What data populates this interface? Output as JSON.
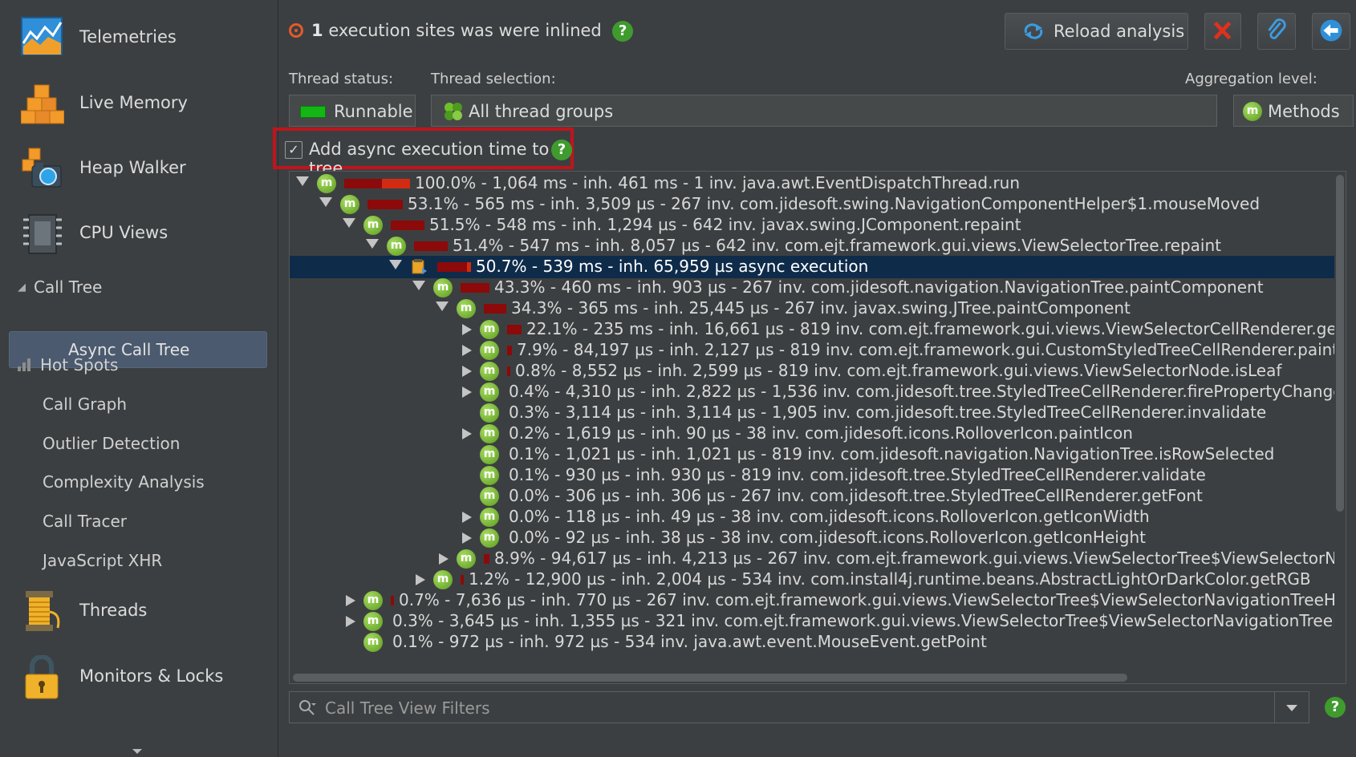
{
  "sidebar": {
    "big_items": [
      {
        "label": "Telemetries",
        "icon": "telemetries-icon"
      },
      {
        "label": "Live Memory",
        "icon": "live-memory-icon"
      },
      {
        "label": "Heap Walker",
        "icon": "heap-walker-icon"
      },
      {
        "label": "CPU Views",
        "icon": "cpu-views-icon"
      }
    ],
    "call_tree": {
      "label": "Call Tree",
      "children": [
        {
          "label": "Async Call Tree",
          "selected": true
        }
      ]
    },
    "hot_spots": {
      "label": "Hot Spots"
    },
    "sub_items": [
      "Call Graph",
      "Outlier Detection",
      "Complexity Analysis",
      "Call Tracer",
      "JavaScript XHR"
    ],
    "bottom_items": [
      {
        "label": "Threads",
        "icon": "threads-icon"
      },
      {
        "label": "Monitors & Locks",
        "icon": "monitors-locks-icon"
      }
    ]
  },
  "header": {
    "inlined_count": "1",
    "inlined_text": "execution sites was were inlined",
    "reload_label": "Reload analysis"
  },
  "filters": {
    "thread_status_label": "Thread status:",
    "thread_status_value": "Runnable",
    "thread_selection_label": "Thread selection:",
    "thread_selection_value": "All thread groups",
    "aggregation_label": "Aggregation level:",
    "aggregation_value": "Methods",
    "async_checkbox_label": "Add async execution time to tree",
    "async_checked": true
  },
  "tree": {
    "rows": [
      {
        "text": "100.0% - 1,064 ms - inh. 461 ms - 1 inv. java.awt.EventDispatchThread.run",
        "depth": 0,
        "expander": "down",
        "percent": 100.0,
        "self_fraction": 0.43
      },
      {
        "text": "53.1% - 565 ms - inh. 3,509 µs - 267 inv. com.jidesoft.swing.NavigationComponentHelper$1.mouseMoved",
        "depth": 1,
        "expander": "down",
        "percent": 53.1,
        "self_fraction": 0.0
      },
      {
        "text": "51.5% - 548 ms - inh. 1,294 µs - 642 inv. javax.swing.JComponent.repaint",
        "depth": 2,
        "expander": "down",
        "percent": 51.5,
        "self_fraction": 0.0
      },
      {
        "text": "51.4% - 547 ms - inh. 8,057 µs - 642 inv. com.ejt.framework.gui.views.ViewSelectorTree.repaint",
        "depth": 3,
        "expander": "down",
        "percent": 51.4,
        "self_fraction": 0.0
      },
      {
        "text": "50.7% - 539 ms - inh. 65,959 µs async execution",
        "depth": 4,
        "expander": "down",
        "percent": 50.7,
        "self_fraction": 0.12,
        "async": true,
        "selected": true
      },
      {
        "text": "43.3% - 460 ms - inh. 903 µs - 267 inv. com.jidesoft.navigation.NavigationTree.paintComponent",
        "depth": 5,
        "expander": "down",
        "percent": 43.3,
        "self_fraction": 0.0
      },
      {
        "text": "34.3% - 365 ms - inh. 25,445 µs - 267 inv. javax.swing.JTree.paintComponent",
        "depth": 6,
        "expander": "down",
        "percent": 34.3,
        "self_fraction": 0.0
      },
      {
        "text": "22.1% - 235 ms - inh. 16,661 µs - 819 inv. com.ejt.framework.gui.views.ViewSelectorCellRenderer.getTreeCel",
        "depth": 7,
        "expander": "right",
        "percent": 22.1,
        "self_fraction": 0.0
      },
      {
        "text": "7.9% - 84,197 µs - inh. 2,127 µs - 819 inv. com.ejt.framework.gui.CustomStyledTreeCellRenderer.paint",
        "depth": 7,
        "expander": "right",
        "percent": 7.9,
        "self_fraction": 0.0
      },
      {
        "text": "0.8% - 8,552 µs - inh. 2,599 µs - 819 inv. com.ejt.framework.gui.views.ViewSelectorNode.isLeaf",
        "depth": 7,
        "expander": "right",
        "percent": 0.8,
        "self_fraction": 0.0
      },
      {
        "text": "0.4% - 4,310 µs - inh. 2,822 µs - 1,536 inv. com.jidesoft.tree.StyledTreeCellRenderer.firePropertyChange",
        "depth": 7,
        "expander": "right",
        "percent": 0.4,
        "self_fraction": 0.0
      },
      {
        "text": "0.3% - 3,114 µs - inh. 3,114 µs - 1,905 inv. com.jidesoft.tree.StyledTreeCellRenderer.invalidate",
        "depth": 7,
        "expander": "none",
        "percent": 0.3,
        "self_fraction": 0.0
      },
      {
        "text": "0.2% - 1,619 µs - inh. 90 µs - 38 inv. com.jidesoft.icons.RolloverIcon.paintIcon",
        "depth": 7,
        "expander": "right",
        "percent": 0.2,
        "self_fraction": 0.0
      },
      {
        "text": "0.1% - 1,021 µs - inh. 1,021 µs - 819 inv. com.jidesoft.navigation.NavigationTree.isRowSelected",
        "depth": 7,
        "expander": "none",
        "percent": 0.1,
        "self_fraction": 0.0
      },
      {
        "text": "0.1% - 930 µs - inh. 930 µs - 819 inv. com.jidesoft.tree.StyledTreeCellRenderer.validate",
        "depth": 7,
        "expander": "none",
        "percent": 0.1,
        "self_fraction": 0.0
      },
      {
        "text": "0.0% - 306 µs - inh. 306 µs - 267 inv. com.jidesoft.tree.StyledTreeCellRenderer.getFont",
        "depth": 7,
        "expander": "none",
        "percent": 0.0,
        "self_fraction": 0.0
      },
      {
        "text": "0.0% - 118 µs - inh. 49 µs - 38 inv. com.jidesoft.icons.RolloverIcon.getIconWidth",
        "depth": 7,
        "expander": "right",
        "percent": 0.0,
        "self_fraction": 0.0
      },
      {
        "text": "0.0% - 92 µs - inh. 38 µs - 38 inv. com.jidesoft.icons.RolloverIcon.getIconHeight",
        "depth": 7,
        "expander": "right",
        "percent": 0.0,
        "self_fraction": 0.0
      },
      {
        "text": "8.9% - 94,617 µs - inh. 4,213 µs - 267 inv. com.ejt.framework.gui.views.ViewSelectorTree$ViewSelectorNavigation",
        "depth": 6,
        "expander": "right",
        "percent": 8.9,
        "self_fraction": 0.0
      },
      {
        "text": "1.2% - 12,900 µs - inh. 2,004 µs - 534 inv. com.install4j.runtime.beans.AbstractLightOrDarkColor.getRGB",
        "depth": 5,
        "expander": "right",
        "percent": 1.2,
        "self_fraction": 0.0
      },
      {
        "text": "0.7% - 7,636 µs - inh. 770 µs - 267 inv. com.ejt.framework.gui.views.ViewSelectorTree$ViewSelectorNavigationTreeHelper.rowAt",
        "depth": 2,
        "expander": "right",
        "percent": 0.7,
        "self_fraction": 0.0
      },
      {
        "text": "0.3% - 3,645 µs - inh. 1,355 µs - 321 inv. com.ejt.framework.gui.views.ViewSelectorTree$ViewSelectorNavigationTreeHelper.getI",
        "depth": 2,
        "expander": "right",
        "percent": 0.3,
        "self_fraction": 0.0
      },
      {
        "text": "0.1% - 972 µs - inh. 972 µs - 534 inv. java.awt.event.MouseEvent.getPoint",
        "depth": 2,
        "expander": "none",
        "percent": 0.1,
        "self_fraction": 0.0
      }
    ]
  },
  "filter": {
    "placeholder": "Call Tree View Filters"
  },
  "colors": {
    "selection": "#0e2b4a",
    "bar_total": "#8c0a0a",
    "bar_self": "#d32a12",
    "highlight_box": "#c0141c",
    "help_green": "#3f9b2d"
  }
}
